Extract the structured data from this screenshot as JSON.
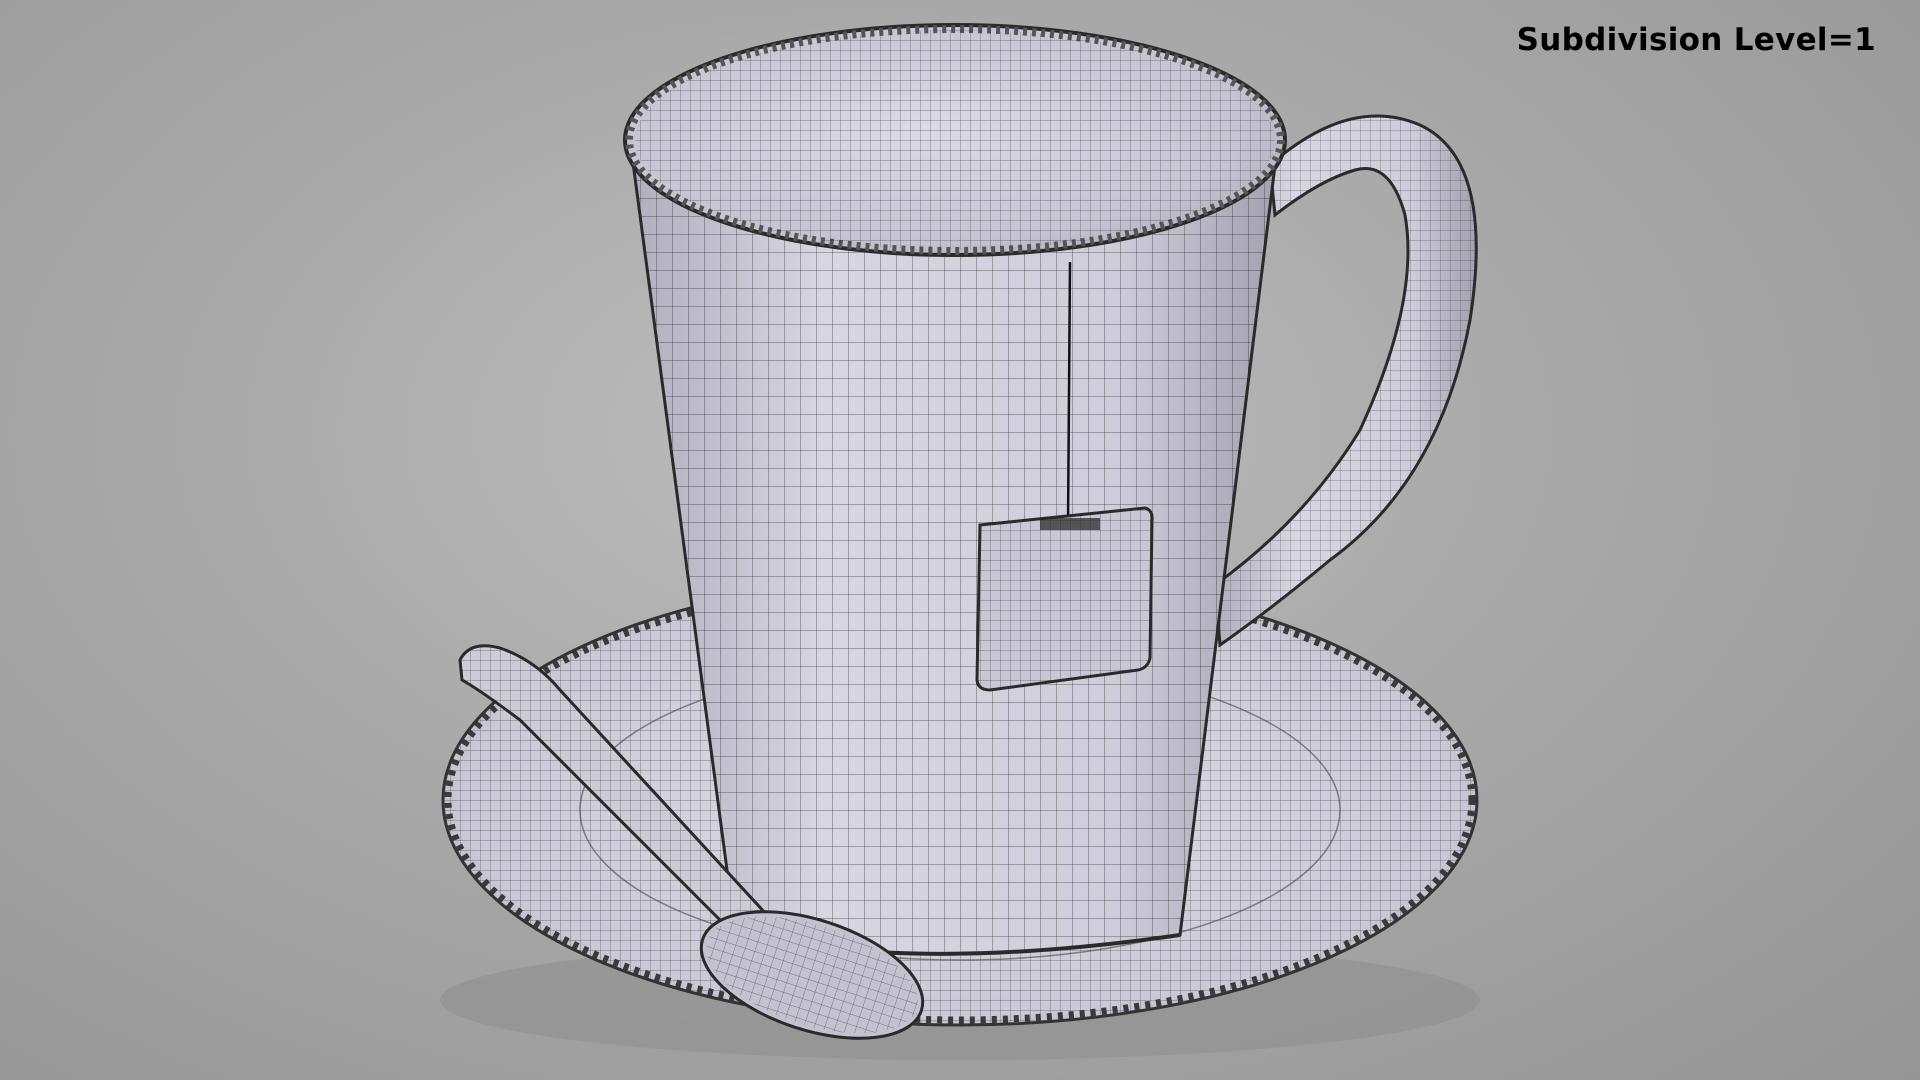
{
  "caption": {
    "text": "Subdivision Level=1"
  },
  "scene": {
    "subject": "teacup-wireframe",
    "colors": {
      "background": "#a9a9a9",
      "surface": "#d9d7e3",
      "surface_shade": "#b4b2c2",
      "wire": "#2a2a2a",
      "rim_band": "#555555"
    }
  }
}
